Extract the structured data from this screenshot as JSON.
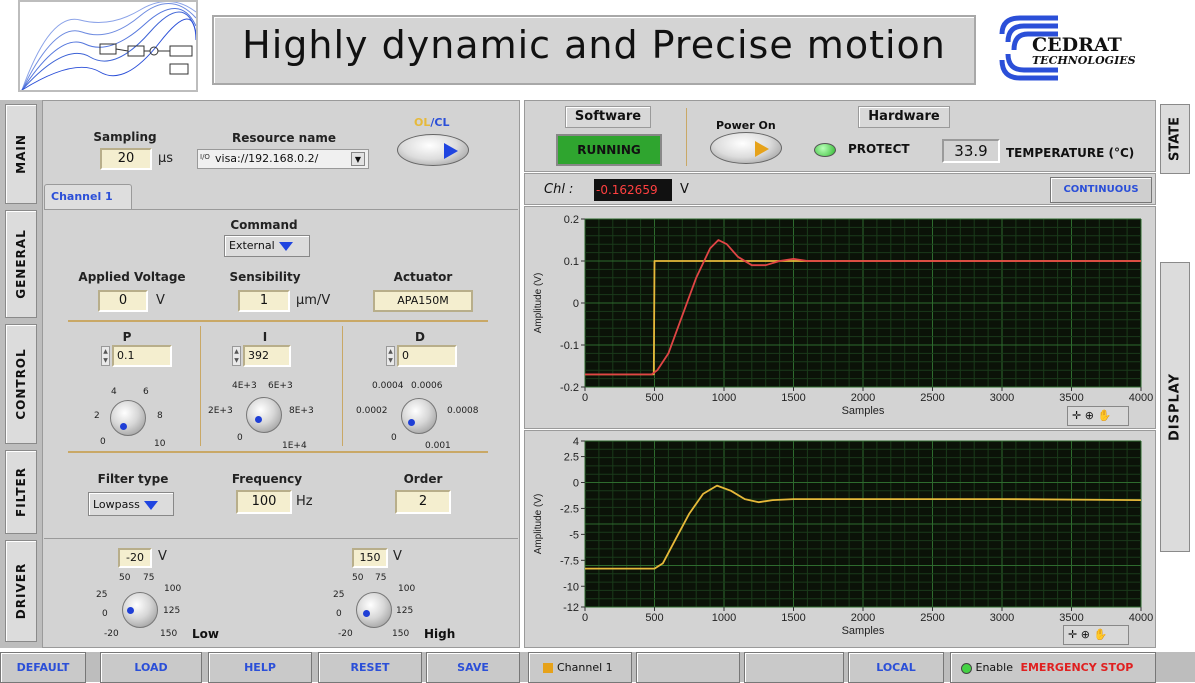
{
  "header": {
    "title": "Highly dynamic and Precise motion",
    "logo_line1": "CEDRAT",
    "logo_line2": "TECHNOLOGIES"
  },
  "side_tabs": {
    "main": "MAIN",
    "general": "GENERAL",
    "control": "CONTROL",
    "filter": "FILTER",
    "driver": "DRIVER"
  },
  "right_tabs": {
    "state": "STATE",
    "display": "DISPLAY"
  },
  "sampling": {
    "label": "Sampling",
    "value": "20",
    "unit": "µs"
  },
  "resource": {
    "label": "Resource name",
    "prefix": "I/O",
    "value": "visa://192.168.0.2/"
  },
  "olcl": {
    "ol": "OL",
    "sep": "/",
    "cl": "CL"
  },
  "channel_tab": "Channel 1",
  "command": {
    "label": "Command",
    "value": "External"
  },
  "applied_voltage": {
    "label": "Applied Voltage",
    "value": "0",
    "unit": "V"
  },
  "sensibility": {
    "label": "Sensibility",
    "value": "1",
    "unit": "µm/V"
  },
  "actuator": {
    "label": "Actuator",
    "value": "APA150M"
  },
  "pid": {
    "p": {
      "label": "P",
      "value": "0.1",
      "ticks": [
        "4",
        "6",
        "2",
        "8",
        "0",
        "10"
      ]
    },
    "i": {
      "label": "I",
      "value": "392",
      "ticks": [
        "4E+3",
        "6E+3",
        "2E+3",
        "8E+3",
        "0",
        "1E+4"
      ]
    },
    "d": {
      "label": "D",
      "value": "0",
      "ticks": [
        "0.0004",
        "0.0006",
        "0.0002",
        "0.0008",
        "0",
        "0.001"
      ]
    },
    "p_level": 0.01,
    "i_level": 0.04,
    "d_level": 0.0
  },
  "filter": {
    "type_label": "Filter type",
    "type_value": "Lowpass",
    "freq_label": "Frequency",
    "freq_value": "100",
    "freq_unit": "Hz",
    "order_label": "Order",
    "order_value": "2"
  },
  "driver": {
    "low": {
      "value": "-20",
      "unit": "V",
      "label": "Low",
      "ticks": [
        "50",
        "75",
        "25",
        "100",
        "0",
        "125",
        "-20",
        "150"
      ]
    },
    "high": {
      "value": "150",
      "unit": "V",
      "label": "High",
      "ticks": [
        "50",
        "75",
        "25",
        "100",
        "0",
        "125",
        "-20",
        "150"
      ]
    }
  },
  "top_right": {
    "software_label": "Software",
    "running_label": "RUNNING",
    "power_label": "Power On",
    "hardware_label": "Hardware",
    "protect_label": "PROTECT",
    "temperature_value": "33.9",
    "temperature_label": "TEMPERATURE (°C)"
  },
  "channel_readout": {
    "label": "Chl :",
    "value": "-0.162659",
    "unit": "V",
    "mode": "CONTINUOUS"
  },
  "bottom_buttons": {
    "default": "DEFAULT",
    "load": "LOAD",
    "help": "HELP",
    "reset": "RESET",
    "save": "SAVE"
  },
  "status_bar": {
    "channel": "Channel 1",
    "local": "LOCAL",
    "enable": "Enable",
    "emergency": "EMERGENCY STOP"
  },
  "colors": {
    "accent_blue": "#2b4fd8",
    "running_green": "#2fa52f",
    "led_green": "#44d244",
    "trace_red": "#e04545",
    "trace_yellow": "#e6b93a",
    "emergency_red": "#e02020"
  },
  "chart_data": [
    {
      "type": "line",
      "xlabel": "Samples",
      "ylabel": "Amplitude (V)",
      "xlim": [
        0,
        4000
      ],
      "ylim": [
        -0.2,
        0.2
      ],
      "x_ticks": [
        "0",
        "500",
        "1000",
        "1500",
        "2000",
        "2500",
        "3000",
        "3500",
        "4000"
      ],
      "y_ticks": [
        "0.2",
        "0.1",
        "0",
        "-0.1",
        "-0.2"
      ],
      "series": [
        {
          "x": [
            0,
            495,
            500,
            4000
          ],
          "y": [
            -0.17,
            -0.17,
            0.1,
            0.1
          ],
          "color": "#e6b93a"
        },
        {
          "x": [
            0,
            480,
            520,
            600,
            700,
            800,
            900,
            960,
            1020,
            1100,
            1200,
            1300,
            1400,
            1500,
            1600,
            1800,
            2000,
            3000,
            4000
          ],
          "y": [
            -0.17,
            -0.17,
            -0.16,
            -0.12,
            -0.03,
            0.06,
            0.13,
            0.15,
            0.14,
            0.11,
            0.09,
            0.09,
            0.1,
            0.105,
            0.1,
            0.1,
            0.1,
            0.1,
            0.1
          ],
          "color": "#e04545"
        }
      ]
    },
    {
      "type": "line",
      "xlabel": "Samples",
      "ylabel": "Amplitude (V)",
      "xlim": [
        0,
        4000
      ],
      "ylim": [
        -12,
        4
      ],
      "x_ticks": [
        "0",
        "500",
        "1000",
        "1500",
        "2000",
        "2500",
        "3000",
        "3500",
        "4000"
      ],
      "y_ticks": [
        "4",
        "2.5",
        "0",
        "-2.5",
        "-5",
        "-7.5",
        "-10",
        "-12"
      ],
      "series": [
        {
          "x": [
            0,
            500,
            560,
            650,
            750,
            850,
            950,
            1050,
            1150,
            1250,
            1350,
            1500,
            1700,
            2000,
            3000,
            4000
          ],
          "y": [
            -8.3,
            -8.3,
            -7.8,
            -5.5,
            -3,
            -1.1,
            -0.3,
            -0.8,
            -1.6,
            -1.9,
            -1.7,
            -1.6,
            -1.6,
            -1.6,
            -1.6,
            -1.7
          ],
          "color": "#e6b93a"
        }
      ]
    }
  ]
}
